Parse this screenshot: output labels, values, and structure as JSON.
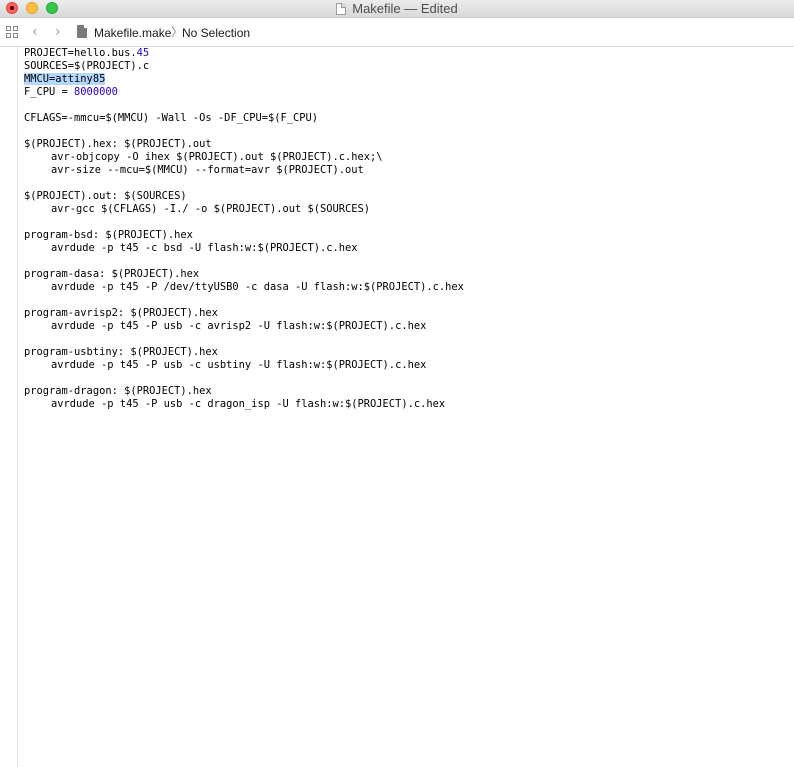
{
  "window": {
    "title": "Makefile — Edited"
  },
  "jumpbar": {
    "grid_icon": "grid-icon",
    "back_glyph": "‹",
    "forward_glyph": "›",
    "file_name": "Makefile.make",
    "separator": "〉",
    "selection": "No Selection"
  },
  "colors": {
    "number_literal": "#2a00c8",
    "selection_highlight": "#b3d7ff",
    "close_button": "#fc605b",
    "minimize_button": "#fdbc40",
    "zoom_button": "#34c84a"
  },
  "code": {
    "l1_text": "PROJECT=hello.bus.",
    "l1_num": "45",
    "l2": "SOURCES=$(PROJECT).c",
    "l3": "MMCU=attiny85",
    "l4_text": "F_CPU = ",
    "l4_num": "8000000",
    "l6": "CFLAGS=-mmcu=$(MMCU) -Wall -Os -DF_CPU=$(F_CPU)",
    "l8": "$(PROJECT).hex: $(PROJECT).out",
    "l9": "avr-objcopy -O ihex $(PROJECT).out $(PROJECT).c.hex;\\",
    "l10": "avr-size --mcu=$(MMCU) --format=avr $(PROJECT).out",
    "l12": "$(PROJECT).out: $(SOURCES)",
    "l13": "avr-gcc $(CFLAGS) -I./ -o $(PROJECT).out $(SOURCES)",
    "l15": "program-bsd: $(PROJECT).hex",
    "l16": "avrdude -p t45 -c bsd -U flash:w:$(PROJECT).c.hex",
    "l18": "program-dasa: $(PROJECT).hex",
    "l19": "avrdude -p t45 -P /dev/ttyUSB0 -c dasa -U flash:w:$(PROJECT).c.hex",
    "l21": "program-avrisp2: $(PROJECT).hex",
    "l22": "avrdude -p t45 -P usb -c avrisp2 -U flash:w:$(PROJECT).c.hex",
    "l24": "program-usbtiny: $(PROJECT).hex",
    "l25": "avrdude -p t45 -P usb -c usbtiny -U flash:w:$(PROJECT).c.hex",
    "l27": "program-dragon: $(PROJECT).hex",
    "l28": "avrdude -p t45 -P usb -c dragon_isp -U flash:w:$(PROJECT).c.hex"
  }
}
